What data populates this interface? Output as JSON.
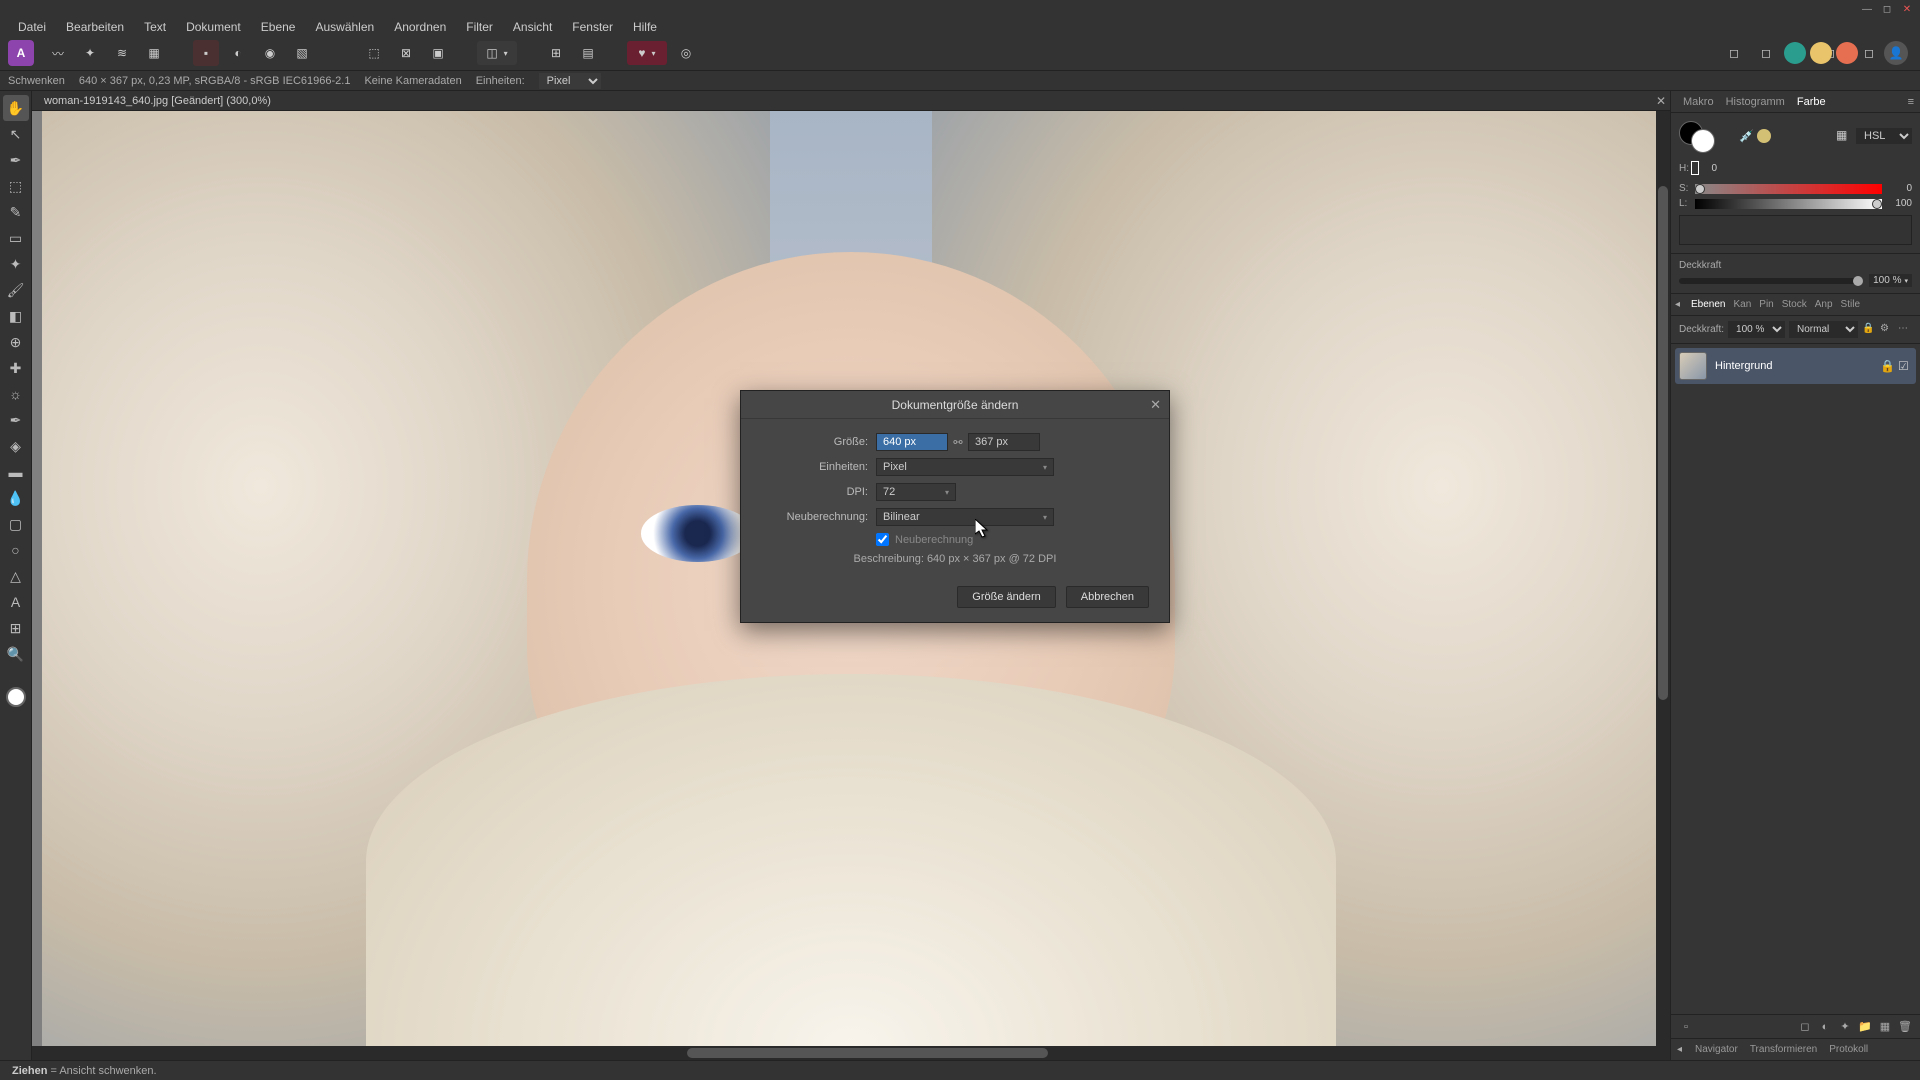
{
  "menubar": [
    "Datei",
    "Bearbeiten",
    "Text",
    "Dokument",
    "Ebene",
    "Auswählen",
    "Anordnen",
    "Filter",
    "Ansicht",
    "Fenster",
    "Hilfe"
  ],
  "contextbar": {
    "tool": "Schwenken",
    "dims": "640 × 367 px, 0,23 MP, sRGBA/8 - sRGB IEC61966-2.1",
    "camera": "Keine Kameradaten",
    "units_label": "Einheiten:",
    "units_value": "Pixel"
  },
  "document_tab": "woman-1919143_640.jpg [Geändert] (300,0%)",
  "right_panel": {
    "tabs_top": [
      "Makro",
      "Histogramm",
      "Farbe"
    ],
    "color_mode": "HSL",
    "hsl": {
      "h_label": "H:",
      "h_val": "0",
      "s_label": "S:",
      "s_val": "0",
      "l_label": "L:",
      "l_val": "100"
    },
    "opacity_label": "Deckkraft",
    "opacity_val": "100 %",
    "layer_tabs": [
      "Ebenen",
      "Kan",
      "Pin",
      "Stock",
      "Anp",
      "Stile"
    ],
    "layer_opts": {
      "opacity_lbl": "Deckkraft:",
      "opacity_val": "100 %",
      "blend": "Normal"
    },
    "layer_name": "Hintergrund",
    "bottom_tabs": [
      "Navigator",
      "Transformieren",
      "Protokoll"
    ]
  },
  "dialog": {
    "title": "Dokumentgröße ändern",
    "size_label": "Größe:",
    "width": "640 px",
    "height": "367 px",
    "units_label": "Einheiten:",
    "units_val": "Pixel",
    "dpi_label": "DPI:",
    "dpi_val": "72",
    "resample_label": "Neuberechnung:",
    "resample_val": "Bilinear",
    "resample_check": "Neuberechnung",
    "desc_label": "Beschreibung:",
    "desc_val": "640 px × 367 px @ 72 DPI",
    "btn_resize": "Größe ändern",
    "btn_cancel": "Abbrechen"
  },
  "statusbar": {
    "bold": "Ziehen",
    "text": " = Ansicht schwenken."
  }
}
